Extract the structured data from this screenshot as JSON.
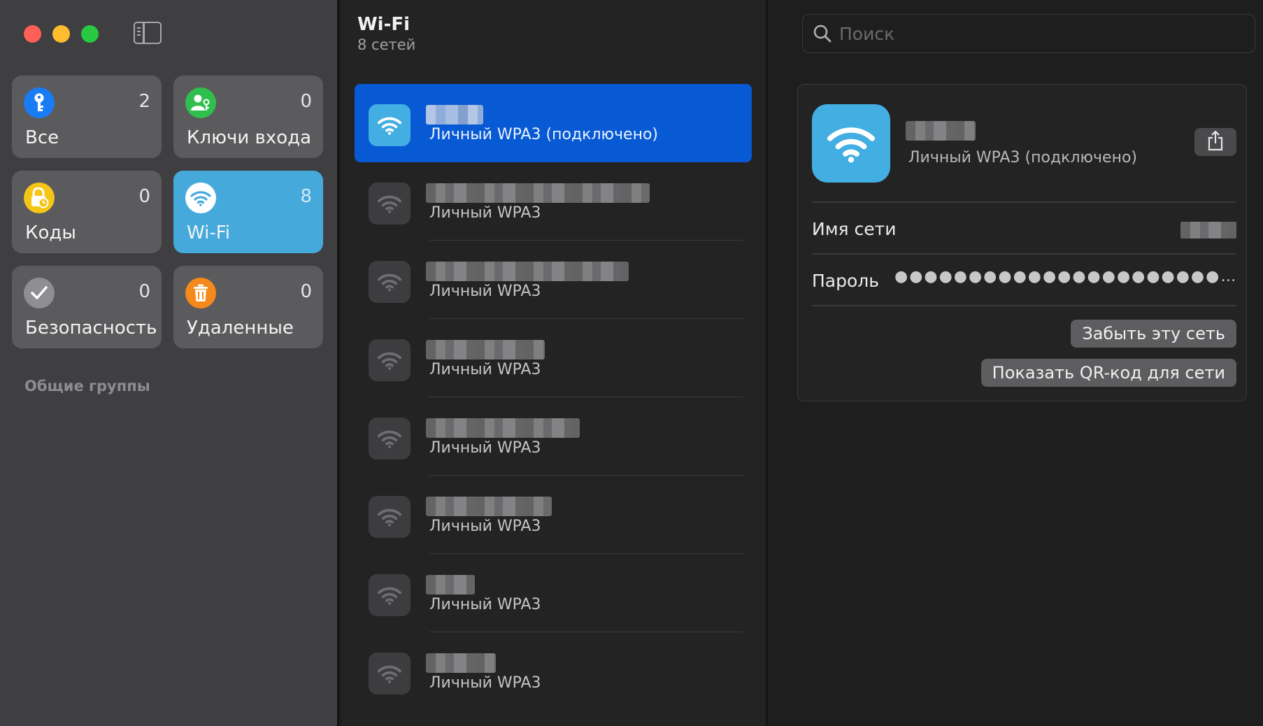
{
  "sidebar": {
    "tiles": [
      {
        "label": "Все",
        "count": "2",
        "icon": "key-icon",
        "color": "#1a7cf5"
      },
      {
        "label": "Ключи входа",
        "count": "0",
        "icon": "person-key-icon",
        "color": "#2fbf4c"
      },
      {
        "label": "Коды",
        "count": "0",
        "icon": "lock-clock-icon",
        "color": "#f5c518"
      },
      {
        "label": "Wi-Fi",
        "count": "8",
        "icon": "wifi-icon",
        "color": "#ffffff",
        "active": true
      },
      {
        "label": "Безопасность",
        "count": "0",
        "icon": "checkmark-icon",
        "color": "#8e8e93"
      },
      {
        "label": "Удаленные",
        "count": "0",
        "icon": "trash-icon",
        "color": "#f58a1a"
      }
    ],
    "section_label": "Общие группы"
  },
  "list": {
    "title": "Wi-Fi",
    "subtitle": "8 сетей",
    "networks": [
      {
        "type": "Личный WPA3 (подключено)",
        "selected": true
      },
      {
        "type": "Личный WPA3"
      },
      {
        "type": "Личный WPA3"
      },
      {
        "type": "Личный WPA3"
      },
      {
        "type": "Личный WPA3"
      },
      {
        "type": "Личный WPA3"
      },
      {
        "type": "Личный WPA3"
      },
      {
        "type": "Личный WPA3"
      }
    ]
  },
  "detail": {
    "search_placeholder": "Поиск",
    "network_type": "Личный WPA3 (подключено)",
    "network_name_label": "Имя сети",
    "password_label": "Пароль",
    "password_mask": "●●●●●●●●●●●●●●●●●●●●●●●●●●●●●●●●●●●●●●",
    "forget_button": "Забыть эту сеть",
    "qr_button": "Показать QR-код для сети"
  },
  "colors": {
    "accent": "#0859d4",
    "wifi_tile": "#45a9dc"
  }
}
